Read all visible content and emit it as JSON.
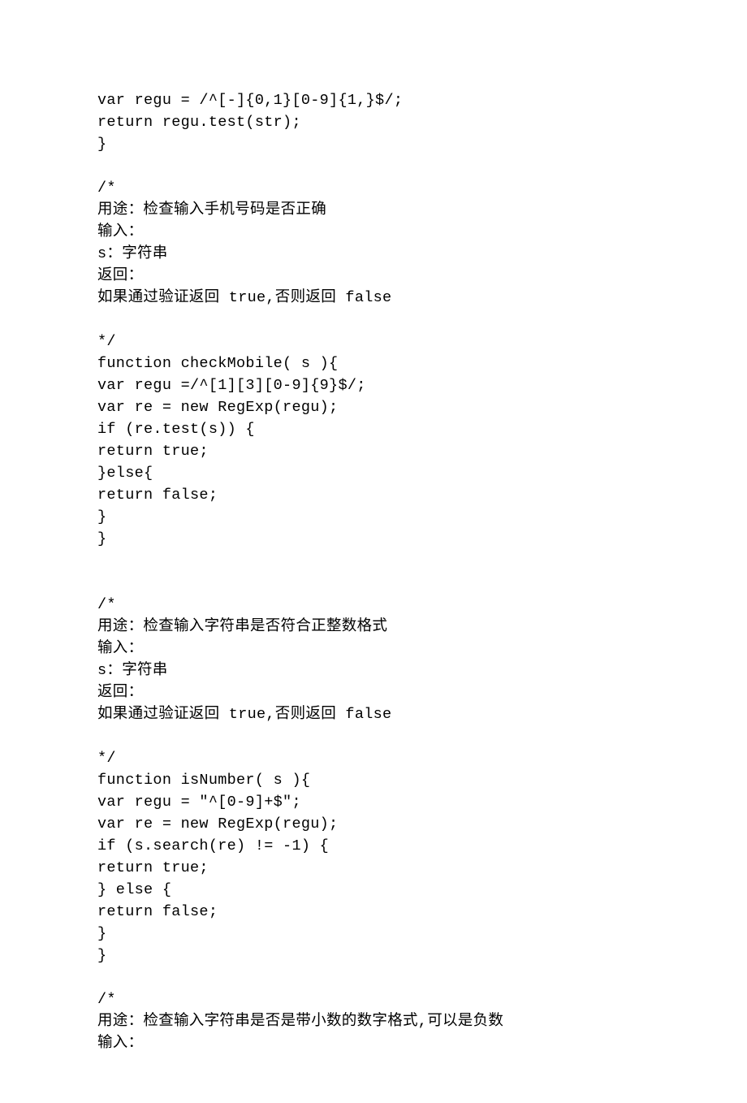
{
  "lines": [
    "var regu = /^[-]{0,1}[0-9]{1,}$/;",
    "return regu.test(str);",
    "}",
    "",
    "/*",
    "用途：检查输入手机号码是否正确",
    "输入：",
    "s：字符串",
    "返回：",
    "如果通过验证返回 true,否则返回 false",
    "",
    "*/",
    "function checkMobile( s ){",
    "var regu =/^[1][3][0-9]{9}$/;",
    "var re = new RegExp(regu);",
    "if (re.test(s)) {",
    "return true;",
    "}else{",
    "return false;",
    "}",
    "}",
    "",
    "",
    "/*",
    "用途：检查输入字符串是否符合正整数格式",
    "输入：",
    "s：字符串",
    "返回：",
    "如果通过验证返回 true,否则返回 false",
    "",
    "*/",
    "function isNumber( s ){",
    "var regu = \"^[0-9]+$\";",
    "var re = new RegExp(regu);",
    "if (s.search(re) != -1) {",
    "return true;",
    "} else {",
    "return false;",
    "}",
    "}",
    "",
    "/*",
    "用途：检查输入字符串是否是带小数的数字格式,可以是负数",
    "输入："
  ]
}
